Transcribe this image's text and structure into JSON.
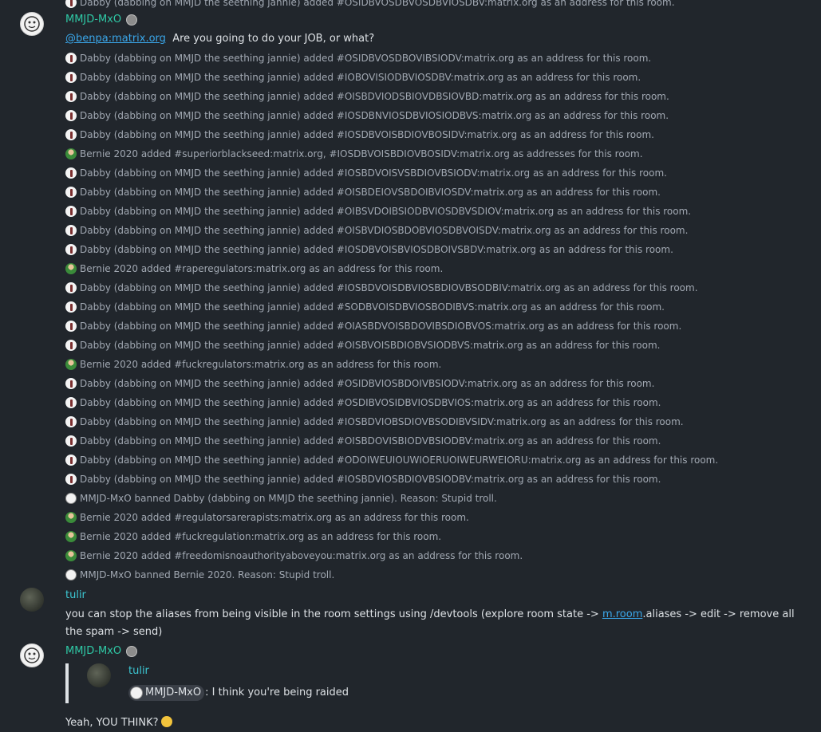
{
  "top_cut_event": "Dabby (dabbing on MMJD the seething jannie) added #OSIDBVOSDBVOSDBVIOSDBV:matrix.org as an address for this room.",
  "msg1": {
    "sender": "MMJD-MxO",
    "mention": "@benpa:matrix.org",
    "text": "Are you going to do your JOB, or what?"
  },
  "events": [
    {
      "icon": "dabby",
      "text": "Dabby (dabbing on MMJD the seething jannie) added #OSIDBVOSDBOVIBSIODV:matrix.org as an address for this room."
    },
    {
      "icon": "dabby",
      "text": "Dabby (dabbing on MMJD the seething jannie) added #IOBOVISIODBVIOSDBV:matrix.org as an address for this room."
    },
    {
      "icon": "dabby",
      "text": "Dabby (dabbing on MMJD the seething jannie) added #OISBDVIODSBIOVDBSIOVBD:matrix.org as an address for this room."
    },
    {
      "icon": "dabby",
      "text": "Dabby (dabbing on MMJD the seething jannie) added #IOSDBNVIOSDBVIOSIODBVS:matrix.org as an address for this room."
    },
    {
      "icon": "dabby",
      "text": "Dabby (dabbing on MMJD the seething jannie) added #IOSDBVOISBDIOVBOSIDV:matrix.org as an address for this room."
    },
    {
      "icon": "bernie",
      "text": "Bernie 2020 added #superiorblackseed:matrix.org, #IOSDBVOISBDIOVBOSIDV:matrix.org as addresses for this room."
    },
    {
      "icon": "dabby",
      "text": "Dabby (dabbing on MMJD the seething jannie) added #IOSBDVOISVSBDIOVBSIODV:matrix.org as an address for this room."
    },
    {
      "icon": "dabby",
      "text": "Dabby (dabbing on MMJD the seething jannie) added #OISBDEIOVSBDOIBVIOSDV:matrix.org as an address for this room."
    },
    {
      "icon": "dabby",
      "text": "Dabby (dabbing on MMJD the seething jannie) added #OIBSVDOIBSIODBVIOSDBVSDIOV:matrix.org as an address for this room."
    },
    {
      "icon": "dabby",
      "text": "Dabby (dabbing on MMJD the seething jannie) added #OISBVDIOSBDOBVIOSDBVOISDV:matrix.org as an address for this room."
    },
    {
      "icon": "dabby",
      "text": "Dabby (dabbing on MMJD the seething jannie) added #IOSDBVOISBVIOSDBOIVSBDV:matrix.org as an address for this room."
    },
    {
      "icon": "bernie",
      "text": "Bernie 2020 added #raperegulators:matrix.org as an address for this room."
    },
    {
      "icon": "dabby",
      "text": "Dabby (dabbing on MMJD the seething jannie) added #IOSBDVOISDBVIOSBDIOVBSODBIV:matrix.org as an address for this room."
    },
    {
      "icon": "dabby",
      "text": "Dabby (dabbing on MMJD the seething jannie) added #SODBVOISDBVIOSBODIBVS:matrix.org as an address for this room."
    },
    {
      "icon": "dabby",
      "text": "Dabby (dabbing on MMJD the seething jannie) added #OIASBDVOISBDOVIBSDIOBVOS:matrix.org as an address for this room."
    },
    {
      "icon": "dabby",
      "text": "Dabby (dabbing on MMJD the seething jannie) added #OISBVOISBDIOBVSIODBVS:matrix.org as an address for this room."
    },
    {
      "icon": "bernie",
      "text": "Bernie 2020 added #fuckregulators:matrix.org as an address for this room."
    },
    {
      "icon": "dabby",
      "text": "Dabby (dabbing on MMJD the seething jannie) added #OSIDBVIOSBDOIVBSIODV:matrix.org as an address for this room."
    },
    {
      "icon": "dabby",
      "text": "Dabby (dabbing on MMJD the seething jannie) added #OSDIBVOSIDBVIOSDBVIOS:matrix.org as an address for this room."
    },
    {
      "icon": "dabby",
      "text": "Dabby (dabbing on MMJD the seething jannie) added #IOSBDVIOBSDIOVBSODIBVSIDV:matrix.org as an address for this room."
    },
    {
      "icon": "dabby",
      "text": "Dabby (dabbing on MMJD the seething jannie) added #OISBDOVISBIODVBSIODBV:matrix.org as an address for this room."
    },
    {
      "icon": "dabby",
      "text": "Dabby (dabbing on MMJD the seething jannie) added #ODOIWEUIOUWIOERUOIWEURWEIORU:matrix.org as an address for this room."
    },
    {
      "icon": "dabby",
      "text": "Dabby (dabbing on MMJD the seething jannie) added #IOSBDVIOSBDIOVBSIODBV:matrix.org as an address for this room."
    },
    {
      "icon": "mmjd",
      "text": "MMJD-MxO banned Dabby (dabbing on MMJD the seething jannie). Reason: Stupid troll."
    },
    {
      "icon": "bernie",
      "text": "Bernie 2020 added #regulatorsarerapists:matrix.org as an address for this room."
    },
    {
      "icon": "bernie",
      "text": "Bernie 2020 added #fuckregulation:matrix.org as an address for this room."
    },
    {
      "icon": "bernie",
      "text": "Bernie 2020 added #freedomisnoauthorityaboveyou:matrix.org as an address for this room."
    },
    {
      "icon": "mmjd",
      "text": "MMJD-MxO banned Bernie 2020. Reason: Stupid troll."
    }
  ],
  "msg2": {
    "sender": "tulir",
    "text_before": "you can stop the aliases from being visible in the room settings using /devtools (explore room state -> ",
    "link": "m.room",
    "text_after": ".aliases -> edit -> remove all the spam -> send)"
  },
  "msg3": {
    "sender": "MMJD-MxO",
    "quote_sender": "tulir",
    "quote_mention": "MMJD-MxO",
    "quote_text": ": I think you're being raided",
    "text": "Yeah, YOU THINK?"
  }
}
